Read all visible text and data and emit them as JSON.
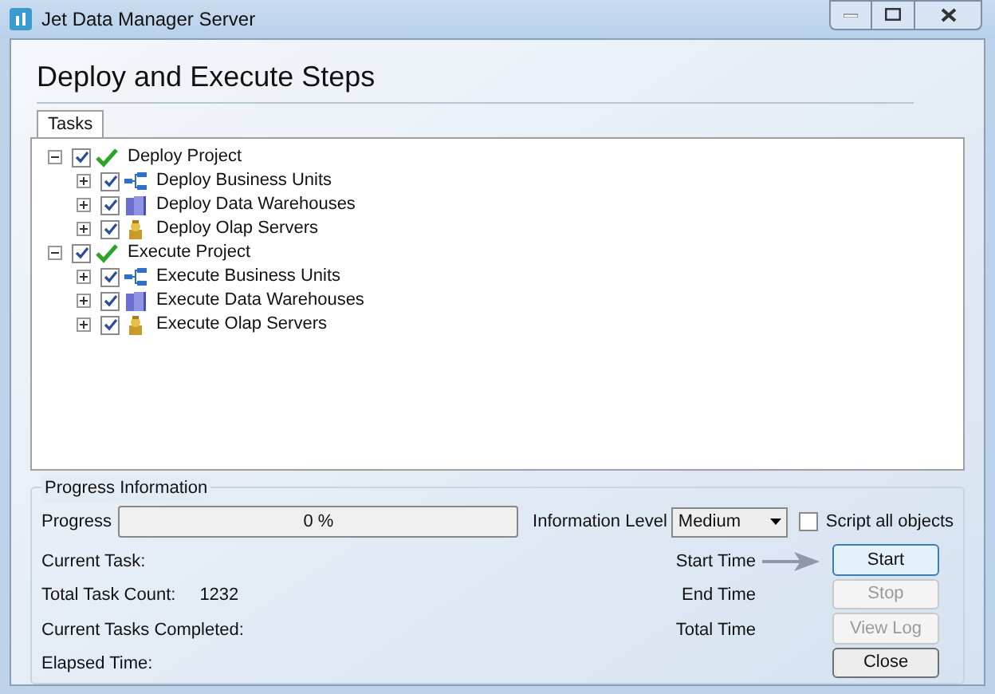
{
  "window": {
    "title": "Jet Data Manager Server"
  },
  "heading": "Deploy and Execute Steps",
  "tabs": [
    {
      "label": "Tasks",
      "selected": true
    }
  ],
  "tree": [
    {
      "label": "Deploy Project",
      "kind": "project",
      "checked": true,
      "expanded": true,
      "children": [
        {
          "label": "Deploy Business Units",
          "kind": "units",
          "checked": true,
          "expanded": false
        },
        {
          "label": "Deploy Data Warehouses",
          "kind": "warehouses",
          "checked": true,
          "expanded": false
        },
        {
          "label": "Deploy Olap Servers",
          "kind": "olap",
          "checked": true,
          "expanded": false
        }
      ]
    },
    {
      "label": "Execute Project",
      "kind": "project",
      "checked": true,
      "expanded": true,
      "children": [
        {
          "label": "Execute Business Units",
          "kind": "units",
          "checked": true,
          "expanded": false
        },
        {
          "label": "Execute Data Warehouses",
          "kind": "warehouses",
          "checked": true,
          "expanded": false
        },
        {
          "label": "Execute Olap Servers",
          "kind": "olap",
          "checked": true,
          "expanded": false
        }
      ]
    }
  ],
  "progress": {
    "group_title": "Progress Information",
    "label": "Progress",
    "level": 0,
    "reading": "0 %",
    "info_level_label": "Information Level",
    "info_level_value": "Medium",
    "script_all": {
      "label": "Script all objects",
      "checked": false
    }
  },
  "details_left": [
    {
      "label": "Current Task:"
    },
    {
      "label": "Total Task Count:",
      "value": "1232"
    },
    {
      "label": "Current Tasks Completed:"
    },
    {
      "label": "Elapsed Time:"
    }
  ],
  "details_right": [
    "Start Time",
    "End Time",
    "Total Time"
  ],
  "buttons": [
    {
      "label": "Start",
      "disabled": false,
      "focused": true
    },
    {
      "label": "Stop",
      "disabled": true,
      "focused": false
    },
    {
      "label": "View Log",
      "disabled": true,
      "focused": false
    },
    {
      "label": "Close",
      "disabled": false,
      "focused": false
    }
  ]
}
